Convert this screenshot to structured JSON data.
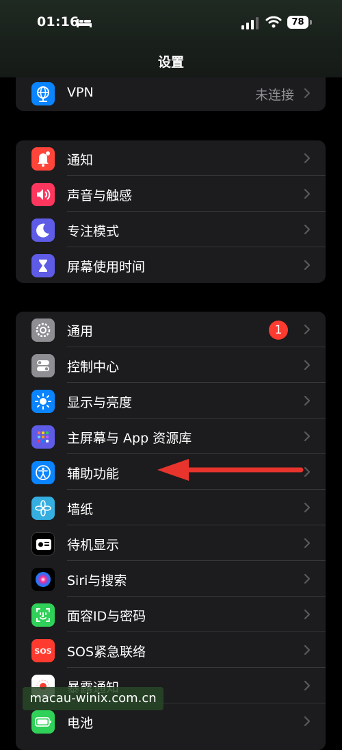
{
  "status_bar": {
    "time": "01:16",
    "battery": "78"
  },
  "nav": {
    "title": "设置"
  },
  "group_vpn": [
    {
      "label": "VPN",
      "value": "未连接",
      "icon": "vpn-globe-icon",
      "color": "#0a84ff"
    }
  ],
  "group_notify": [
    {
      "label": "通知",
      "icon": "bell-icon",
      "color": "#ff453a"
    },
    {
      "label": "声音与触感",
      "icon": "speaker-icon",
      "color": "#ff375f"
    },
    {
      "label": "专注模式",
      "icon": "moon-icon",
      "color": "#5e5ce6"
    },
    {
      "label": "屏幕使用时间",
      "icon": "hourglass-icon",
      "color": "#5e5ce6"
    }
  ],
  "group_general": [
    {
      "label": "通用",
      "badge": "1",
      "icon": "gear-icon",
      "color": "#8e8e93"
    },
    {
      "label": "控制中心",
      "icon": "toggles-icon",
      "color": "#8e8e93"
    },
    {
      "label": "显示与亮度",
      "icon": "sun-icon",
      "color": "#0a84ff"
    },
    {
      "label": "主屏幕与 App 资源库",
      "icon": "home-grid-icon",
      "color": "#5e5ce6"
    },
    {
      "label": "辅助功能",
      "icon": "accessibility-icon",
      "color": "#0a84ff"
    },
    {
      "label": "墙纸",
      "icon": "flower-icon",
      "color": "#35aee0"
    },
    {
      "label": "待机显示",
      "icon": "standby-icon",
      "color": "#000000"
    },
    {
      "label": "Siri与搜索",
      "icon": "siri-icon",
      "color": "#2c2c2e"
    },
    {
      "label": "面容ID与密码",
      "icon": "faceid-icon",
      "color": "#30d158"
    },
    {
      "label": "SOS紧急联络",
      "icon": "sos-icon",
      "color": "#ff3b30"
    },
    {
      "label": "暴露通知",
      "icon": "exposure-icon",
      "color": "#ffffff"
    },
    {
      "label": "电池",
      "icon": "battery-icon",
      "color": "#30d158"
    }
  ],
  "watermark": "macau-winix.com.cn"
}
